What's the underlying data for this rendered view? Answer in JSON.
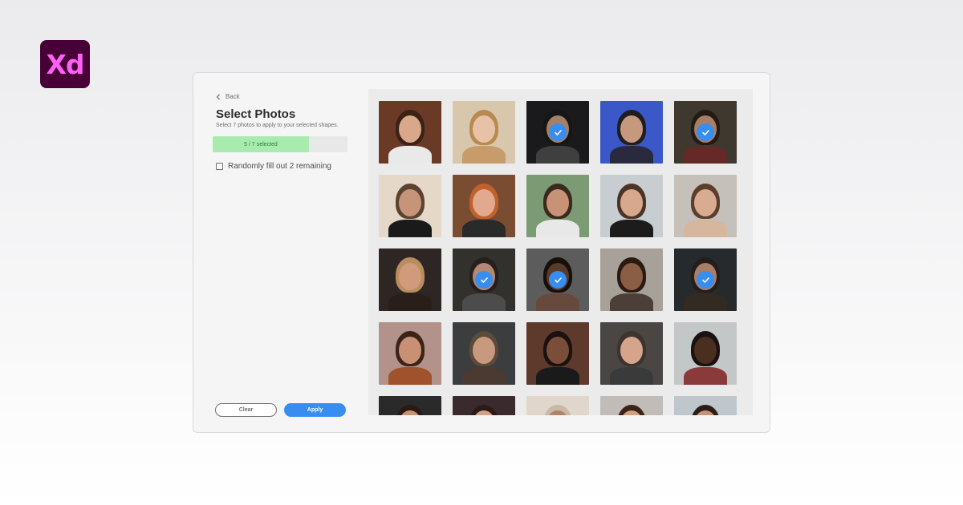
{
  "logo": {
    "text": "Xd"
  },
  "panel": {
    "back_label": "Back",
    "title": "Select Photos",
    "subtitle": "Select 7 photos to apply to your selected shapes.",
    "progress": {
      "text": "5 / 7 selected",
      "selected": 5,
      "total": 7
    },
    "random_option": {
      "label": "Randomly fill out 2 remaining",
      "checked": false
    },
    "clear_label": "Clear",
    "apply_label": "Apply"
  },
  "colors": {
    "accent": "#378ef0",
    "progress_fill": "#a7ecae",
    "xd_bg": "#470137",
    "xd_text": "#ff61f6"
  },
  "photos": [
    {
      "id": "photo-1",
      "selected": false,
      "bg": "#6b3a26",
      "skin": "#d9a88a",
      "hair": "#3a2216",
      "body": "#e9e9e9"
    },
    {
      "id": "photo-2",
      "selected": false,
      "bg": "#d9c7ad",
      "skin": "#e8c2a6",
      "hair": "#b98a4f",
      "body": "#c89c6a"
    },
    {
      "id": "photo-3",
      "selected": true,
      "bg": "#1f1f21",
      "skin": "#c49678",
      "hair": "#1b1b1b",
      "body": "#4a4a4a"
    },
    {
      "id": "photo-4",
      "selected": false,
      "bg": "#3a58c8",
      "skin": "#c6987e",
      "hair": "#1e1e1e",
      "body": "#2a2a3e"
    },
    {
      "id": "photo-5",
      "selected": true,
      "bg": "#4b4238",
      "skin": "#c89478",
      "hair": "#2a2018",
      "body": "#7a2f2f"
    },
    {
      "id": "photo-6",
      "selected": false,
      "bg": "#e6d8c8",
      "skin": "#c69478",
      "hair": "#5b4332",
      "body": "#1a1a1a"
    },
    {
      "id": "photo-7",
      "selected": false,
      "bg": "#7a4d32",
      "skin": "#e2a98e",
      "hair": "#c0622e",
      "body": "#2a2a2a"
    },
    {
      "id": "photo-8",
      "selected": false,
      "bg": "#7c9a73",
      "skin": "#c89276",
      "hair": "#3a2a1e",
      "body": "#e8e8e8"
    },
    {
      "id": "photo-9",
      "selected": false,
      "bg": "#c7cdd0",
      "skin": "#d8a88e",
      "hair": "#4a3426",
      "body": "#1c1c1c"
    },
    {
      "id": "photo-10",
      "selected": false,
      "bg": "#c6c0ba",
      "skin": "#d9ab90",
      "hair": "#5b3e2b",
      "body": "#d4b79c"
    },
    {
      "id": "photo-11",
      "selected": false,
      "bg": "#2e2624",
      "skin": "#d19a7c",
      "hair": "#b88e5c",
      "body": "#2a1e1a"
    },
    {
      "id": "photo-12",
      "selected": true,
      "bg": "#3c3a36",
      "skin": "#d1a086",
      "hair": "#2e2520",
      "body": "#5a5a5a"
    },
    {
      "id": "photo-13",
      "selected": true,
      "bg": "#6d6d6d",
      "skin": "#6a4532",
      "hair": "#1a120e",
      "body": "#7a5848"
    },
    {
      "id": "photo-14",
      "selected": false,
      "bg": "#a7a19a",
      "skin": "#8a5e44",
      "hair": "#2a1a12",
      "body": "#4c3f38"
    },
    {
      "id": "photo-15",
      "selected": true,
      "bg": "#2e3236",
      "skin": "#c79479",
      "hair": "#2a2420",
      "body": "#3d3228"
    },
    {
      "id": "photo-16",
      "selected": false,
      "bg": "#b2928a",
      "skin": "#c99075",
      "hair": "#3a2418",
      "body": "#a0522d"
    },
    {
      "id": "photo-17",
      "selected": false,
      "bg": "#3b3d3e",
      "skin": "#c7997e",
      "hair": "#5c4a3a",
      "body": "#4a3a32"
    },
    {
      "id": "photo-18",
      "selected": false,
      "bg": "#5e3a2c",
      "skin": "#7b4e3a",
      "hair": "#1a1210",
      "body": "#1a1a1a"
    },
    {
      "id": "photo-19",
      "selected": false,
      "bg": "#4a4644",
      "skin": "#d6a48a",
      "hair": "#3b3430",
      "body": "#3a3a3a"
    },
    {
      "id": "photo-20",
      "selected": false,
      "bg": "#c4c7c8",
      "skin": "#4a2e20",
      "hair": "#1a1210",
      "body": "#8a3a3a"
    },
    {
      "id": "photo-21",
      "selected": false,
      "bg": "#2a2a2a",
      "skin": "#c89478",
      "hair": "#2a1a14",
      "body": "#2a2a2a"
    },
    {
      "id": "photo-22",
      "selected": false,
      "bg": "#3a2a2e",
      "skin": "#d4a286",
      "hair": "#2a1a1a",
      "body": "#4a3a3a"
    },
    {
      "id": "photo-23",
      "selected": false,
      "bg": "#e0d6cc",
      "skin": "#b08366",
      "hair": "#c8b8a8",
      "body": "#d8ccc0"
    },
    {
      "id": "photo-24",
      "selected": false,
      "bg": "#c2bcb8",
      "skin": "#d2a084",
      "hair": "#3a2418",
      "body": "#5a5a5a"
    },
    {
      "id": "photo-25",
      "selected": false,
      "bg": "#bfc6cc",
      "skin": "#c89476",
      "hair": "#2a1e18",
      "body": "#e4e4e4"
    }
  ]
}
